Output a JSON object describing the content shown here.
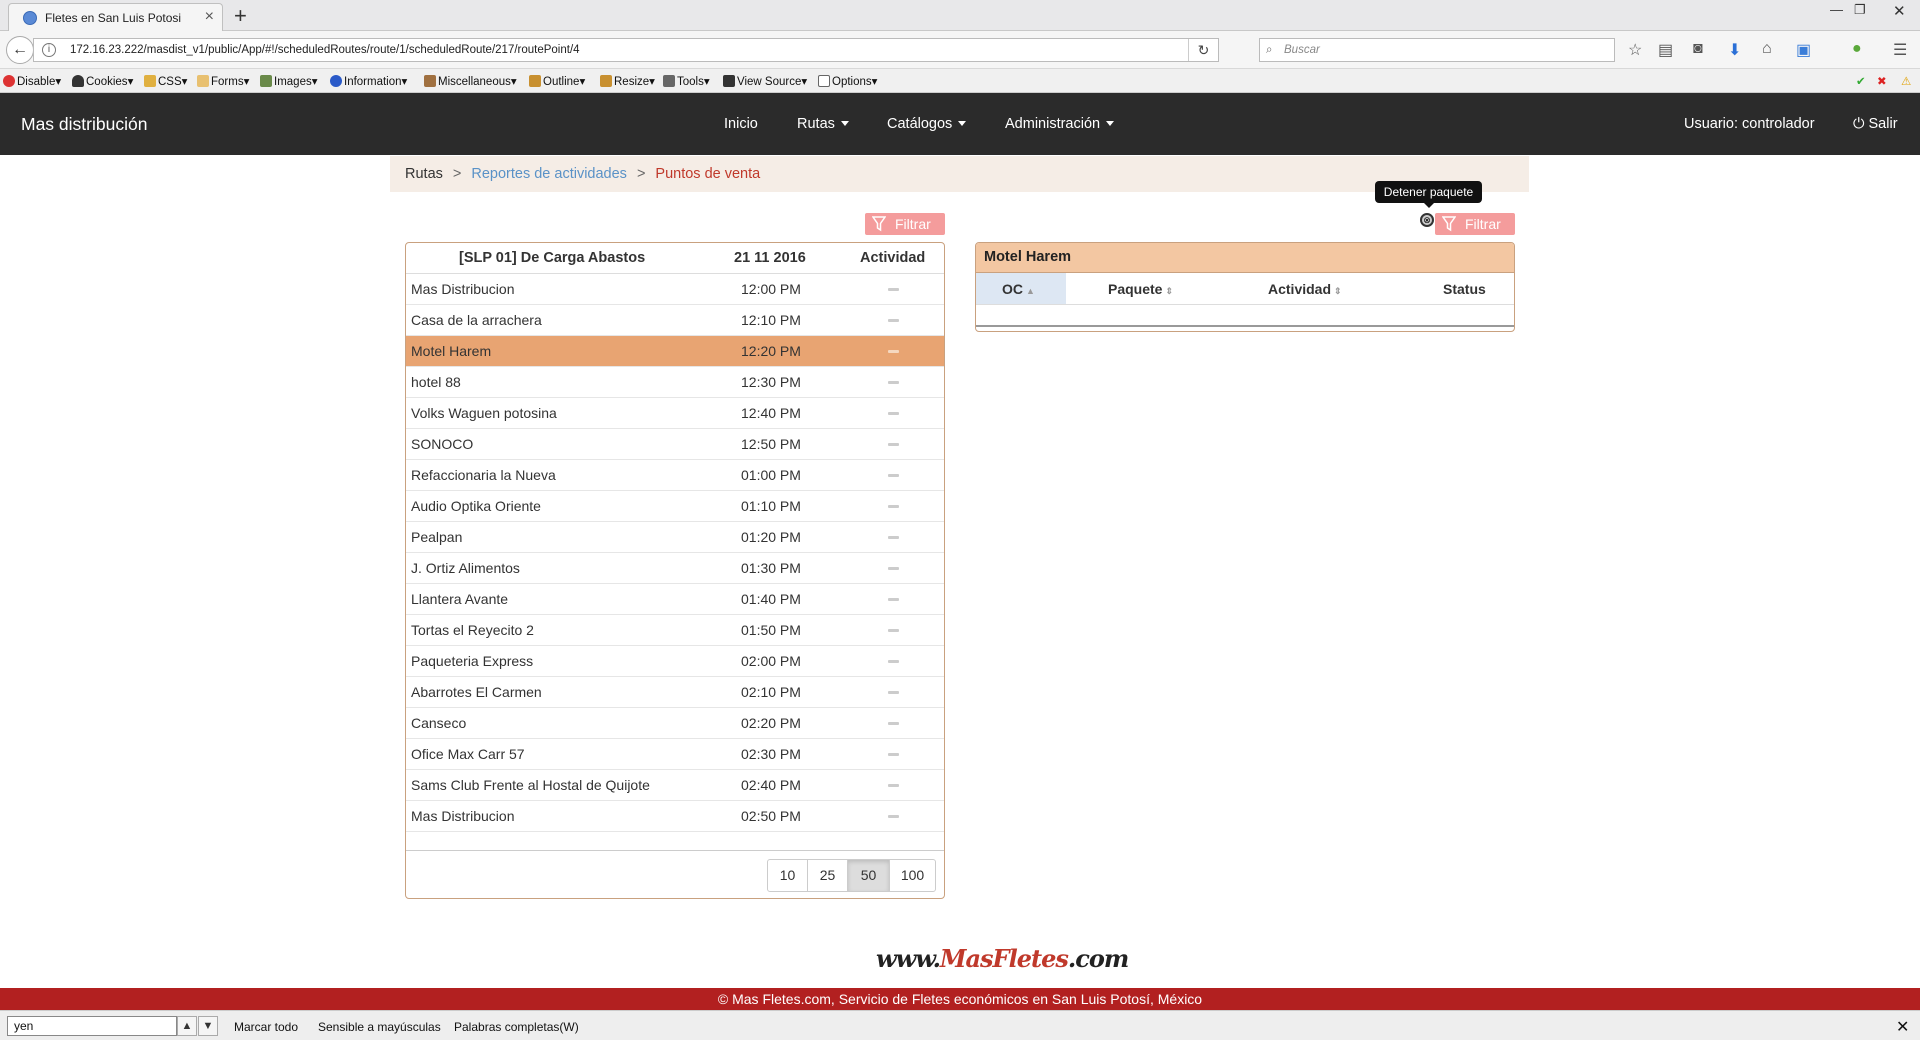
{
  "browser": {
    "tab_title": "Fletes en San Luis Potosi",
    "new_tab": "+",
    "url": "172.16.23.222/masdist_v1/public/App/#!/scheduledRoutes/route/1/scheduledRoute/217/routePoint/4",
    "search_placeholder": "Buscar",
    "devbar": [
      "Disable",
      "Cookies",
      "CSS",
      "Forms",
      "Images",
      "Information",
      "Miscellaneous",
      "Outline",
      "Resize",
      "Tools",
      "View Source",
      "Options"
    ]
  },
  "app": {
    "brand": "Mas distribución",
    "menu": {
      "inicio": "Inicio",
      "rutas": "Rutas",
      "catalogos": "Catálogos",
      "admin": "Administración"
    },
    "user": "Usuario: controlador",
    "logout": "Salir"
  },
  "breadcrumb": {
    "b1": "Rutas",
    "sep": ">",
    "b2": "Reportes de actividades",
    "b3": "Puntos de venta"
  },
  "filter_label": "Filtrar",
  "tooltip": "Detener paquete",
  "left_table": {
    "headers": {
      "name": "[SLP 01] De Carga Abastos",
      "date": "21 11 2016",
      "activity": "Actividad"
    },
    "rows": [
      {
        "name": "Mas Distribucion",
        "time": "12:00 PM"
      },
      {
        "name": "Casa de la arrachera",
        "time": "12:10 PM"
      },
      {
        "name": "Motel Harem",
        "time": "12:20 PM"
      },
      {
        "name": "hotel 88",
        "time": "12:30 PM"
      },
      {
        "name": "Volks Waguen potosina",
        "time": "12:40 PM"
      },
      {
        "name": "SONOCO",
        "time": "12:50 PM"
      },
      {
        "name": "Refaccionaria la Nueva",
        "time": "01:00 PM"
      },
      {
        "name": "Audio Optika Oriente",
        "time": "01:10 PM"
      },
      {
        "name": "Pealpan",
        "time": "01:20 PM"
      },
      {
        "name": "J. Ortiz Alimentos",
        "time": "01:30 PM"
      },
      {
        "name": "Llantera Avante",
        "time": "01:40 PM"
      },
      {
        "name": "Tortas el Reyecito 2",
        "time": "01:50 PM"
      },
      {
        "name": "Paqueteria Express",
        "time": "02:00 PM"
      },
      {
        "name": "Abarrotes El Carmen",
        "time": "02:10 PM"
      },
      {
        "name": "Canseco",
        "time": "02:20 PM"
      },
      {
        "name": "Ofice Max Carr 57",
        "time": "02:30 PM"
      },
      {
        "name": "Sams Club Frente al Hostal de Quijote",
        "time": "02:40 PM"
      },
      {
        "name": "Mas Distribucion",
        "time": "02:50 PM"
      }
    ],
    "selected_index": 2,
    "page_sizes": [
      "10",
      "25",
      "50",
      "100"
    ],
    "active_page_size": "50"
  },
  "right_panel": {
    "title": "Motel Harem",
    "headers": {
      "oc": "OC",
      "paquete": "Paquete",
      "actividad": "Actividad",
      "status": "Status"
    }
  },
  "footer": {
    "logo_main": "www.",
    "logo_brand": "MasFletes",
    "logo_tld": ".com",
    "copyright": "© Mas Fletes.com, Servicio de Fletes económicos en San Luis Potosí, México"
  },
  "findbar": {
    "query": "yen",
    "highlight_all": "Marcar todo",
    "match_case": "Sensible a mayúsculas",
    "whole_words": "Palabras completas(W)"
  },
  "colors": {
    "navbar": "#2b2b2b",
    "selected_row": "#e8a472",
    "panel_header": "#f3c7a2",
    "filter_button": "#f49c9c",
    "footer": "#b22020"
  }
}
